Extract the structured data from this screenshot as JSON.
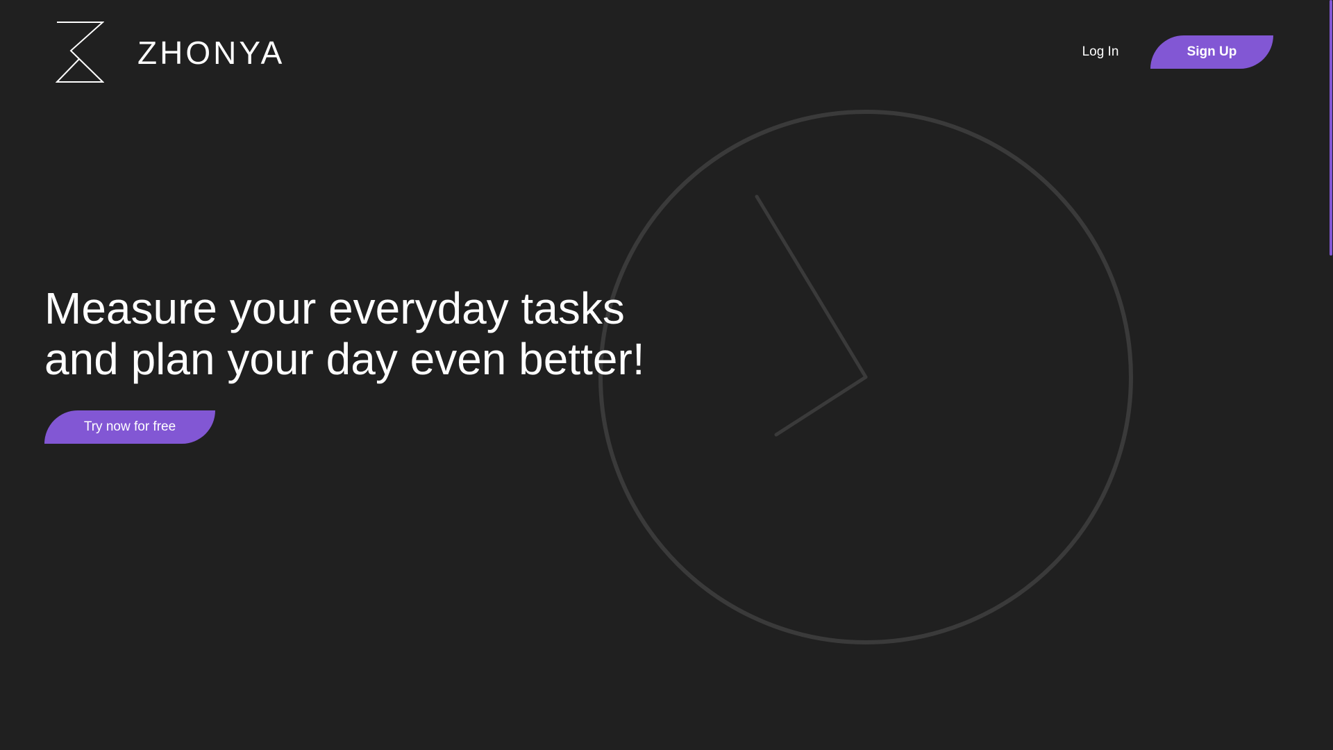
{
  "header": {
    "brand_name": "ZHONYA",
    "login_label": "Log In",
    "signup_label": "Sign Up"
  },
  "hero": {
    "title_line1": "Measure your everyday tasks",
    "title_line2": "and plan your day even better!",
    "cta_label": "Try now for free"
  },
  "icons": {
    "logo": "hourglass-icon",
    "clock": "clock-icon"
  },
  "colors": {
    "background": "#202020",
    "accent": "#8257d4",
    "clock_stroke": "#3a3a3a",
    "text": "#ffffff"
  }
}
